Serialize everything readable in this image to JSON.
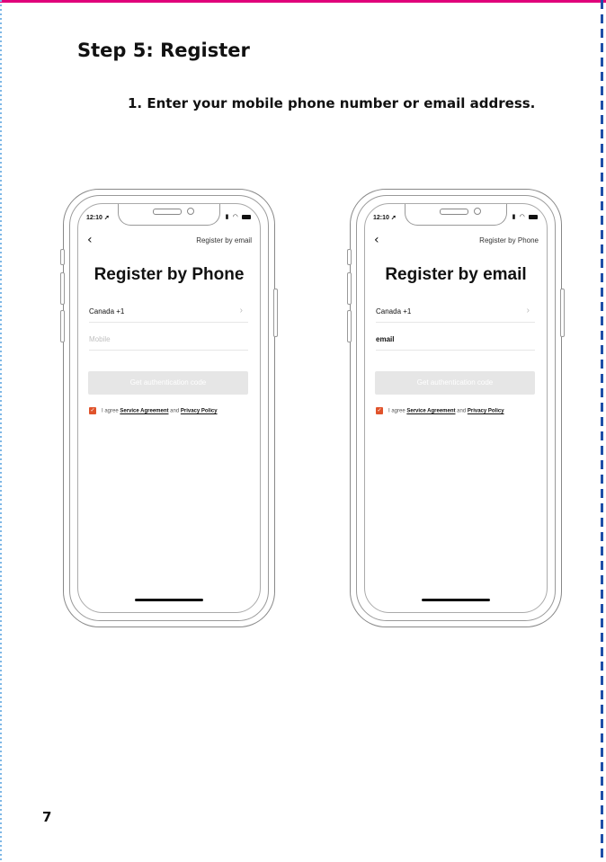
{
  "heading": "Step 5: Register",
  "instruction": "1. Enter your mobile phone number or email address.",
  "page_number": "7",
  "colors": {
    "top_rule": "#e0007a",
    "right_edge": "#1f4fa8",
    "checkbox": "#e0532b"
  },
  "phones": [
    {
      "status_time": "12:10",
      "nav_link": "Register by email",
      "title": "Register by Phone",
      "country": "Canada +1",
      "input_placeholder": "Mobile",
      "input_value": "",
      "button": "Get authentication code",
      "agree_prefix": "I agree",
      "service_link": "Service Agreement",
      "agree_and": "and",
      "privacy_link": "Privacy Policy"
    },
    {
      "status_time": "12:10",
      "nav_link": "Register by Phone",
      "title": "Register by email",
      "country": "Canada +1",
      "input_placeholder": "",
      "input_value": "email",
      "button": "Get authentication code",
      "agree_prefix": "I agree",
      "service_link": "Service Agreement",
      "agree_and": "and",
      "privacy_link": "Privacy Policy"
    }
  ]
}
